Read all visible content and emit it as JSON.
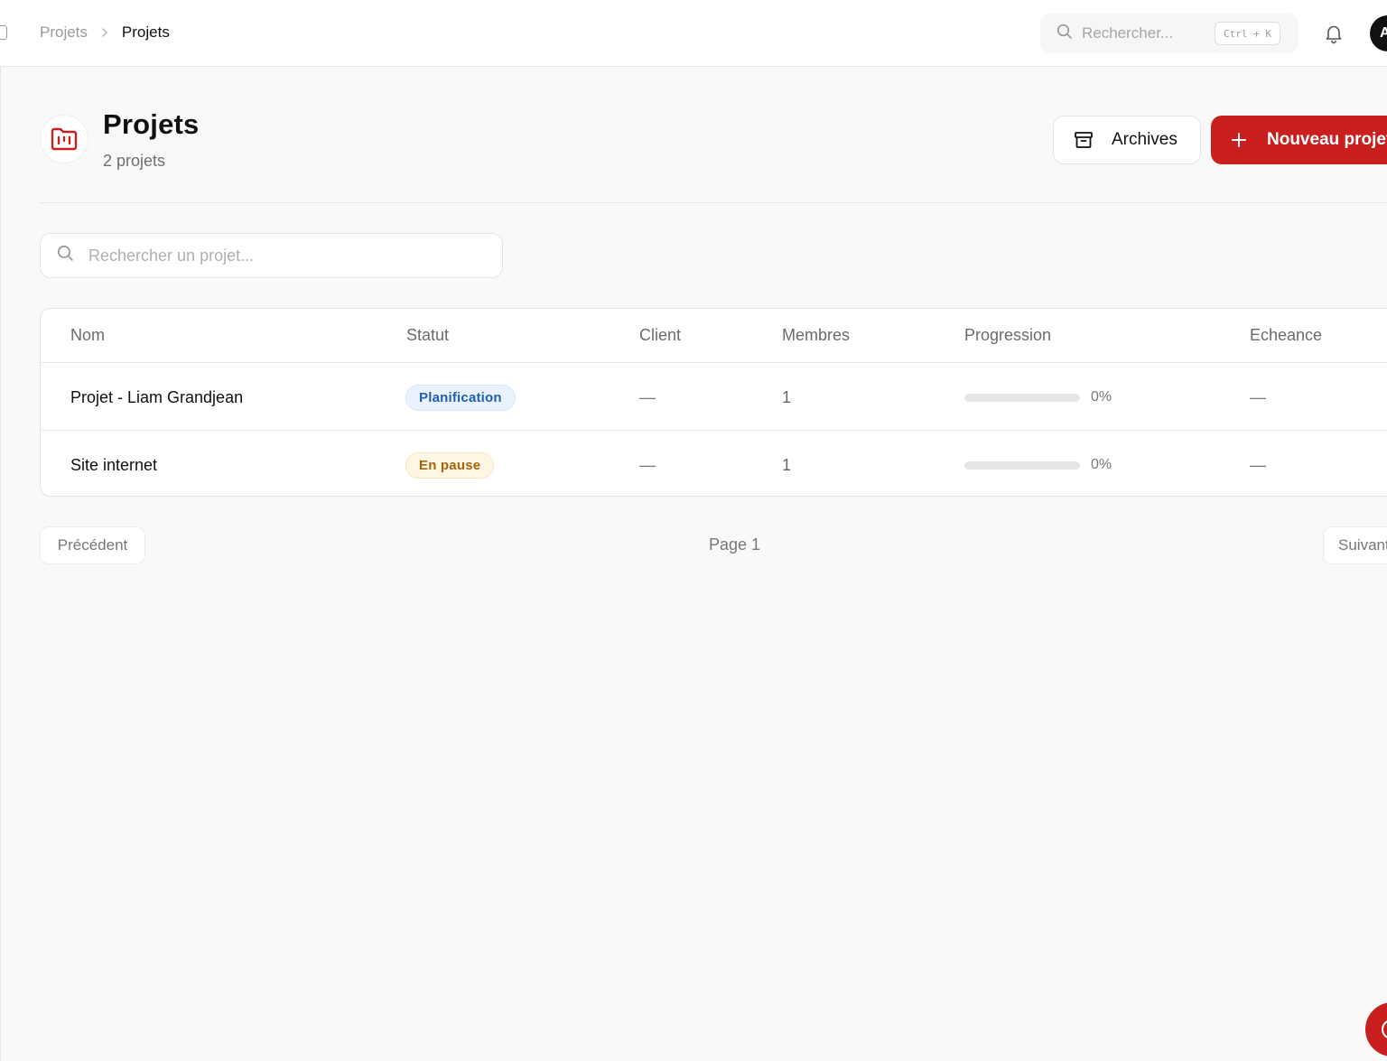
{
  "topbar": {
    "breadcrumb": {
      "parent": "Projets",
      "current": "Projets"
    },
    "search": {
      "placeholder": "Rechercher...",
      "shortcut": "Ctrl + K"
    },
    "avatar_initial": "A"
  },
  "header": {
    "title": "Projets",
    "subtitle": "2 projets",
    "archives_label": "Archives",
    "new_project_label": "Nouveau projet"
  },
  "filter": {
    "search_placeholder": "Rechercher un projet..."
  },
  "table": {
    "columns": [
      "Nom",
      "Statut",
      "Client",
      "Membres",
      "Progression",
      "Echeance"
    ],
    "rows": [
      {
        "name": "Projet - Liam Grandjean",
        "status": "Planification",
        "client": "—",
        "members": "1",
        "progress": 0,
        "progress_label": "0%",
        "due": "—"
      },
      {
        "name": "Site internet",
        "status": "En pause",
        "client": "—",
        "members": "1",
        "progress": 0,
        "progress_label": "0%",
        "due": "—"
      }
    ]
  },
  "pagination": {
    "prev_label": "Précédent",
    "page_label": "Page 1",
    "next_label": "Suivant"
  },
  "colors": {
    "accent": "#c9201f",
    "status_planification_bg": "#eaf2fd",
    "status_planification_fg": "#1f5fb8",
    "status_pause_bg": "#fdf6e2",
    "status_pause_fg": "#a8640a"
  }
}
